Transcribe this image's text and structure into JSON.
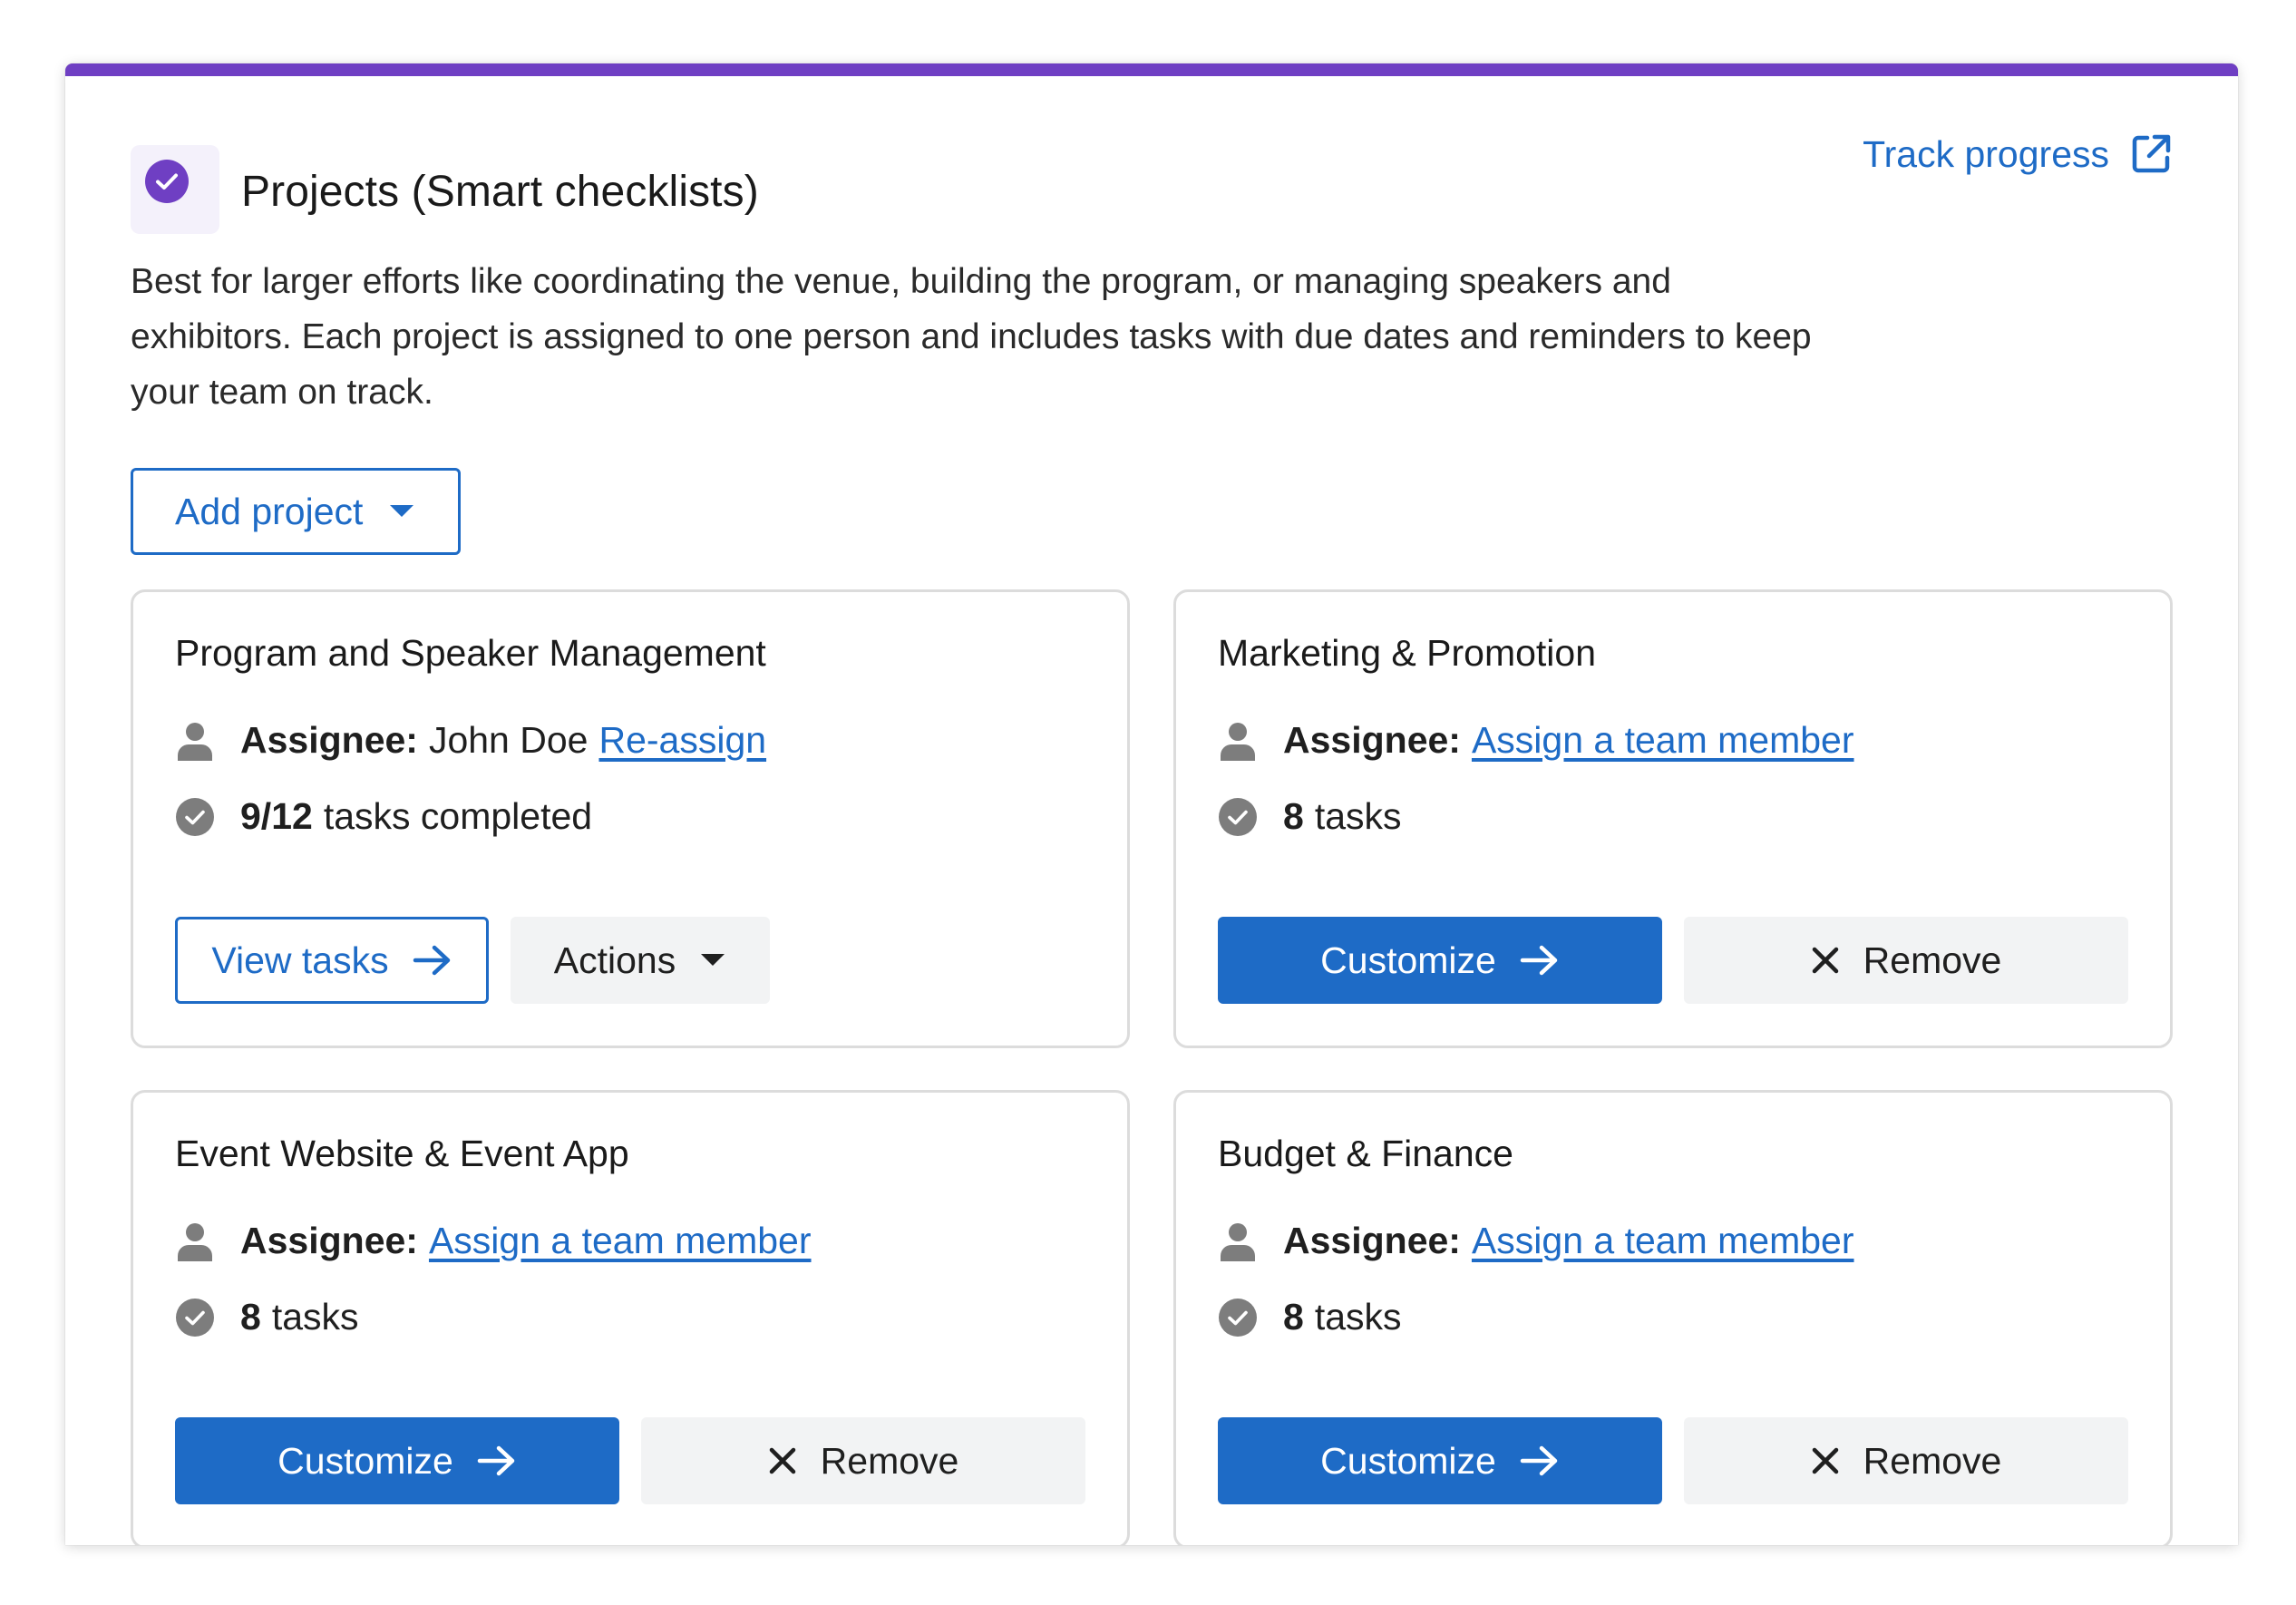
{
  "header": {
    "title": "Projects (Smart checklists)",
    "badge_icon": "check-circle-icon",
    "accent_color": "#6f3fc3"
  },
  "track_progress": {
    "label": "Track progress",
    "icon": "external-link-icon"
  },
  "description": "Best for larger efforts like coordinating the venue, building the program, or managing speakers and exhibitors. Each project is assigned to one person and includes tasks with due dates and reminders to keep your team on track.",
  "add_project": {
    "label": "Add project",
    "icon": "caret-down-icon"
  },
  "colors": {
    "primary": "#1e6bc6",
    "card_border": "#dcdcdc",
    "secondary_button": "#f2f3f4"
  },
  "cards": [
    {
      "title": "Program and Speaker Management",
      "assignee_label": "Assignee:",
      "assignee_name": "John Doe",
      "assignee_link": "Re-assign",
      "tasks_count": "9/12",
      "tasks_label": "tasks completed",
      "primary_button": "View tasks",
      "secondary_button": "Actions"
    },
    {
      "title": "Marketing & Promotion",
      "assignee_label": "Assignee:",
      "assignee_link": "Assign a team member",
      "tasks_count": "8",
      "tasks_label": "tasks",
      "primary_button": "Customize",
      "secondary_button": "Remove"
    },
    {
      "title": "Event Website & Event App",
      "assignee_label": "Assignee:",
      "assignee_link": "Assign a team member",
      "tasks_count": "8",
      "tasks_label": "tasks",
      "primary_button": "Customize",
      "secondary_button": "Remove"
    },
    {
      "title": "Budget & Finance",
      "assignee_label": "Assignee:",
      "assignee_link": "Assign a team member",
      "tasks_count": "8",
      "tasks_label": "tasks",
      "primary_button": "Customize",
      "secondary_button": "Remove"
    }
  ]
}
